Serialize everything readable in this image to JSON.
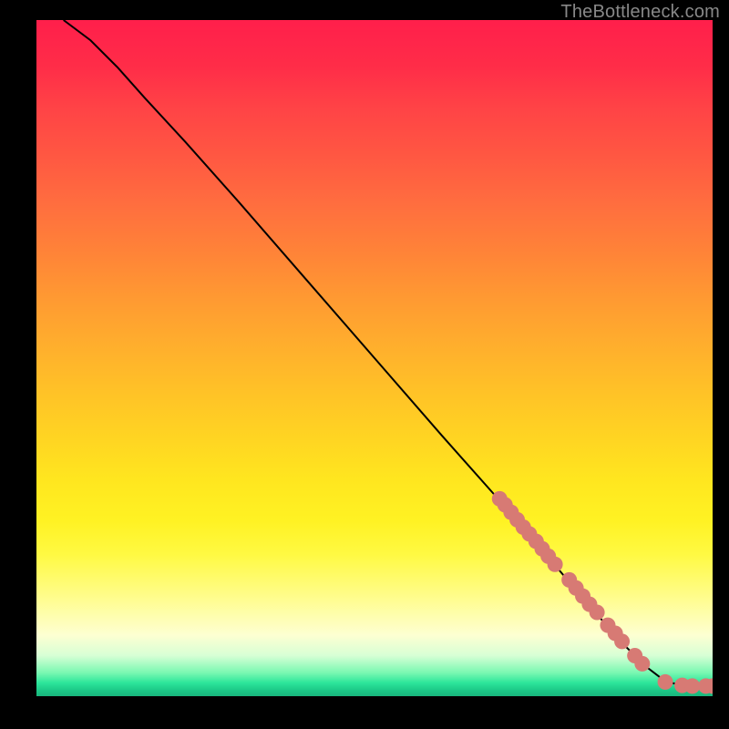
{
  "watermark": "TheBottleneck.com",
  "colors": {
    "curve": "#000000",
    "marker_fill": "#d77a74",
    "marker_stroke": "#d77a74",
    "background": "#000000"
  },
  "chart_data": {
    "type": "line",
    "title": "",
    "xlabel": "",
    "ylabel": "",
    "xlim": [
      0,
      100
    ],
    "ylim": [
      0,
      100
    ],
    "grid": false,
    "curve": {
      "x_start": 4,
      "y_start": 100,
      "x_end": 100,
      "y_end": 1.5
    },
    "series": [
      {
        "name": "curve",
        "type": "line",
        "x": [
          4,
          8,
          12,
          16,
          22,
          30,
          40,
          50,
          60,
          68,
          74,
          80,
          86,
          90,
          93,
          95.5,
          97,
          98.2,
          99,
          100
        ],
        "y": [
          100,
          97,
          93,
          88.5,
          82,
          73,
          61.5,
          50,
          38.5,
          29.5,
          22.5,
          15.5,
          8.5,
          4.5,
          2.2,
          1.6,
          1.5,
          1.5,
          1.5,
          1.5
        ]
      },
      {
        "name": "markers",
        "type": "scatter",
        "x": [
          68.5,
          69.3,
          70.2,
          71.1,
          72.0,
          72.9,
          73.9,
          74.8,
          75.7,
          76.7,
          78.8,
          79.8,
          80.8,
          81.8,
          82.9,
          84.5,
          85.6,
          86.6,
          88.5,
          89.6,
          93.0,
          95.5,
          97.0,
          99.0,
          100.0
        ],
        "y": [
          29.2,
          28.3,
          27.2,
          26.1,
          25.0,
          24.0,
          22.9,
          21.8,
          20.7,
          19.5,
          17.2,
          16.0,
          14.8,
          13.6,
          12.4,
          10.5,
          9.3,
          8.1,
          6.0,
          4.8,
          2.1,
          1.6,
          1.5,
          1.5,
          1.5
        ]
      }
    ]
  }
}
